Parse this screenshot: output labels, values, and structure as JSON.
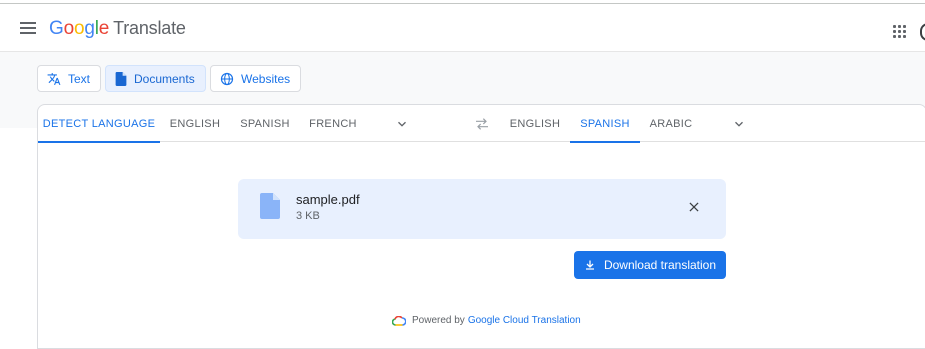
{
  "header": {
    "logo_letters": [
      "G",
      "o",
      "o",
      "g",
      "l",
      "e"
    ],
    "product_name": "Translate"
  },
  "modes": [
    {
      "label": "Text",
      "icon": "translate-icon",
      "active": false
    },
    {
      "label": "Documents",
      "icon": "document-icon",
      "active": true
    },
    {
      "label": "Websites",
      "icon": "globe-icon",
      "active": false
    }
  ],
  "source_languages": {
    "tabs": [
      "DETECT LANGUAGE",
      "ENGLISH",
      "SPANISH",
      "FRENCH"
    ],
    "active": "DETECT LANGUAGE"
  },
  "target_languages": {
    "tabs": [
      "ENGLISH",
      "SPANISH",
      "ARABIC"
    ],
    "active": "SPANISH"
  },
  "file": {
    "name": "sample.pdf",
    "size": "3 KB"
  },
  "download_button": {
    "label": "Download translation"
  },
  "footer": {
    "powered_by": "Powered by",
    "link_text": "Google Cloud Translation"
  },
  "colors": {
    "accent": "#1a73e8",
    "file_box_bg": "#e8f0fe",
    "text_secondary": "#5f6368"
  }
}
